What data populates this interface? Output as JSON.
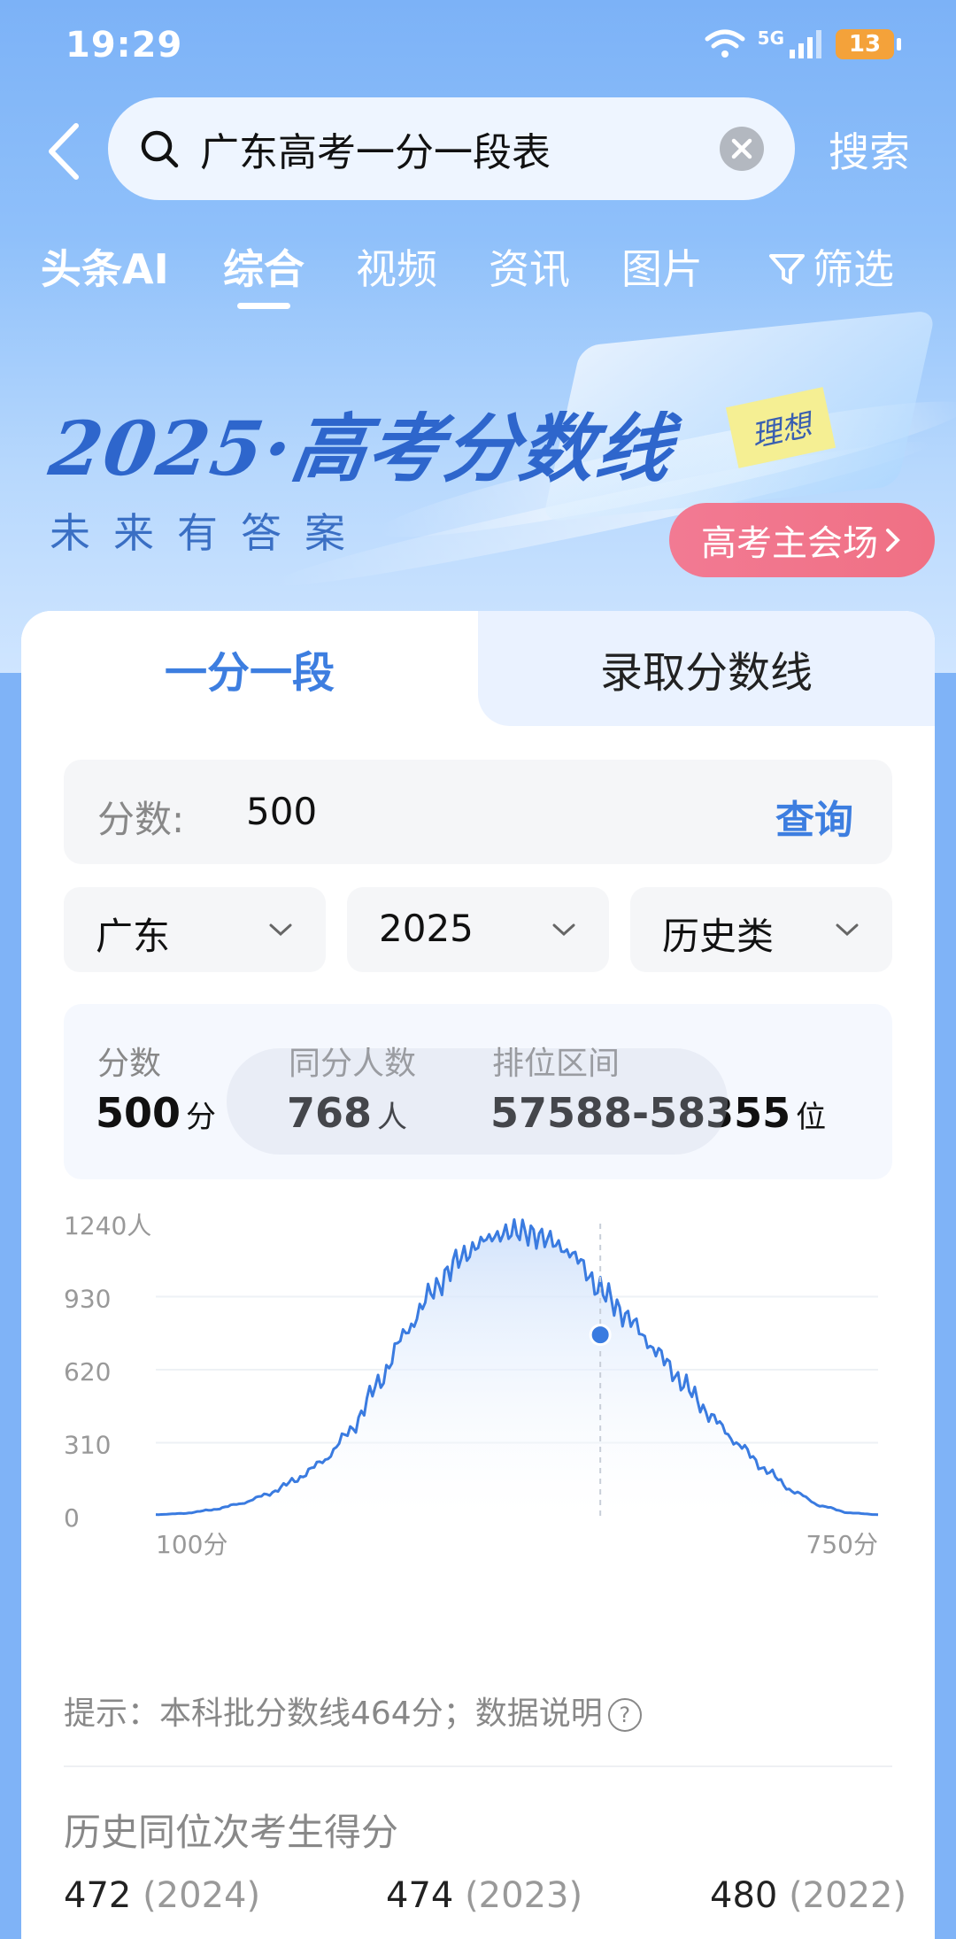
{
  "status_bar": {
    "time": "19:29",
    "network": "5G",
    "battery": "13"
  },
  "search": {
    "query": "广东高考一分一段表",
    "button_label": "搜索"
  },
  "tabs": [
    "头条AI",
    "综合",
    "视频",
    "资讯",
    "图片",
    "筛选"
  ],
  "banner": {
    "title": "2025·高考分数线",
    "subtitle": "未来有答案",
    "note": "理想",
    "button_label": "高考主会场"
  },
  "card": {
    "segments": [
      "一分一段",
      "录取分数线"
    ],
    "score_field": {
      "label": "分数:",
      "value": "500",
      "query_label": "查询"
    },
    "selects": [
      "广东",
      "2025",
      "历史类"
    ],
    "stats": {
      "score_label": "分数",
      "score_value": "500",
      "score_unit": "分",
      "same_label": "同分人数",
      "same_value": "768",
      "same_unit": "人",
      "rank_label": "排位区间",
      "rank_value": "57588-58355",
      "rank_unit": "位"
    },
    "tip": "提示：本科批分数线464分；数据说明",
    "history_title": "历史同位次考生得分",
    "history": [
      {
        "score": "472",
        "year": "(2024)"
      },
      {
        "score": "474",
        "year": "(2023)"
      },
      {
        "score": "480",
        "year": "(2022)"
      }
    ]
  },
  "chart_data": {
    "type": "area",
    "title": "",
    "xlabel": "",
    "ylabel": "",
    "y_ticks": [
      "1240人",
      "930",
      "620",
      "310",
      "0"
    ],
    "x_ticks": [
      "100分",
      "750分"
    ],
    "xlim": [
      100,
      750
    ],
    "ylim": [
      0,
      1240
    ],
    "highlight": {
      "x": 500,
      "y": 768
    },
    "x": [
      100,
      125,
      150,
      175,
      200,
      225,
      250,
      275,
      300,
      325,
      350,
      375,
      400,
      425,
      450,
      475,
      500,
      525,
      550,
      575,
      600,
      625,
      650,
      675,
      700,
      725,
      750
    ],
    "y": [
      5,
      10,
      25,
      50,
      90,
      150,
      230,
      360,
      560,
      780,
      960,
      1100,
      1180,
      1210,
      1180,
      1110,
      960,
      840,
      700,
      560,
      420,
      300,
      190,
      100,
      40,
      12,
      5
    ],
    "grid": true,
    "legend": "none",
    "colors": {
      "line": "#3a7be0",
      "fill": "#cfe1fb"
    }
  }
}
